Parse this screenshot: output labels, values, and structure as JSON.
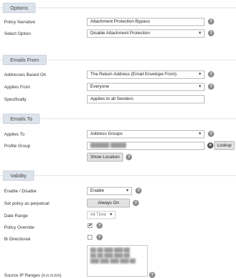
{
  "sections": {
    "options": "Options",
    "emails_from": "Emails From",
    "emails_to": "Emails To",
    "validity": "Validity"
  },
  "options": {
    "policy_narrative_label": "Policy Narrative",
    "policy_narrative_value": "Attachment Protection Bypass",
    "select_option_label": "Select Option",
    "select_option_value": "Disable Attachment Protection"
  },
  "emails_from": {
    "addresses_based_on_label": "Addresses Based On",
    "addresses_based_on_value": "The Return Address (Email Envelope From)",
    "applies_from_label": "Applies From",
    "applies_from_value": "Everyone",
    "specifically_label": "Specifically",
    "specifically_value": "Applies to all Senders"
  },
  "emails_to": {
    "applies_to_label": "Applies To",
    "applies_to_value": "Address Groups",
    "profile_group_label": "Profile Group",
    "profile_group_value": "██████ █████",
    "lookup_label": "Lookup",
    "show_location_label": "Show Location"
  },
  "validity": {
    "enable_disable_label": "Enable / Disable",
    "enable_disable_value": "Enable",
    "perpetual_label": "Set policy as perpetual",
    "always_on_label": "Always On",
    "date_range_label": "Date Range",
    "date_range_value": "All Time",
    "policy_override_label": "Policy Override",
    "policy_override_checked": true,
    "bi_directional_label": "Bi Directional",
    "bi_directional_checked": false,
    "source_ip_label": "Source IP Ranges (n.n.n.n/x)",
    "source_ip_lines": [
      "██.██.███.███/██",
      "██.██.███.███/██",
      "███.███.███.███/██"
    ]
  },
  "help_glyph": "?",
  "checkmark_glyph": "✔",
  "clear_glyph": "×"
}
